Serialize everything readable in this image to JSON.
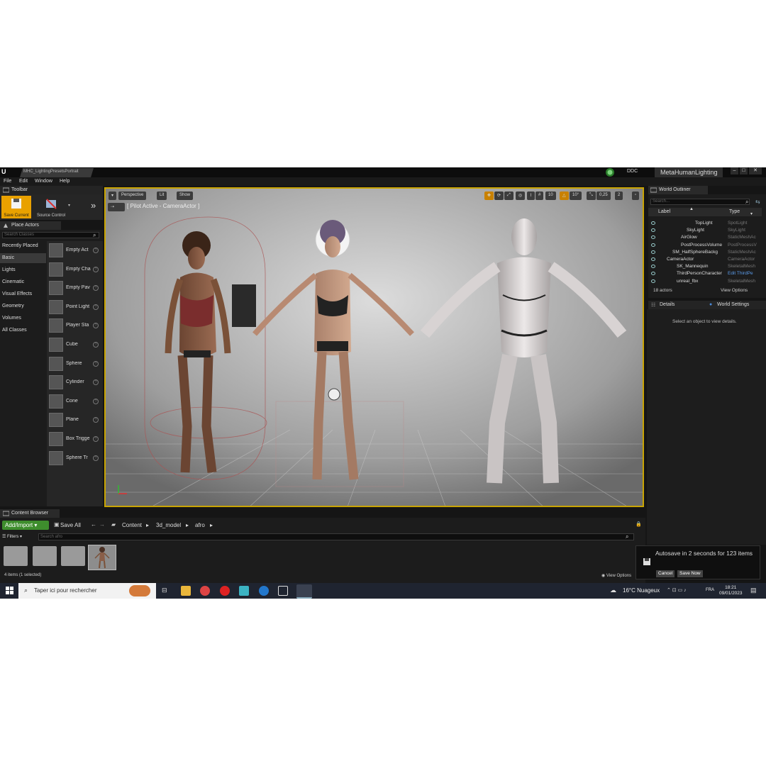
{
  "window": {
    "level_tab": "MHC_LightingPresetsPortrait",
    "ddc_label": "DDC",
    "project_name": "MetaHumanLighting"
  },
  "menu": [
    "File",
    "Edit",
    "Window",
    "Help"
  ],
  "toolbar": {
    "tab_label": "Toolbar",
    "save_current": "Save Current",
    "source_control": "Source Control"
  },
  "place_actors": {
    "tab_label": "Place Actors",
    "search_placeholder": "Search Classes",
    "categories": [
      "Recently Placed",
      "Basic",
      "Lights",
      "Cinematic",
      "Visual Effects",
      "Geometry",
      "Volumes",
      "All Classes"
    ],
    "active_category": "Basic",
    "actors": [
      {
        "label": "Empty Act",
        "icon": "sphere-icon"
      },
      {
        "label": "Empty Cha",
        "icon": "character-icon"
      },
      {
        "label": "Empty Pav",
        "icon": "pawn-icon"
      },
      {
        "label": "Point Light",
        "icon": "bulb-icon"
      },
      {
        "label": "Player Sta",
        "icon": "player-start-icon"
      },
      {
        "label": "Cube",
        "icon": "cube-icon"
      },
      {
        "label": "Sphere",
        "icon": "sphere-icon"
      },
      {
        "label": "Cylinder",
        "icon": "cylinder-icon"
      },
      {
        "label": "Cone",
        "icon": "cone-icon"
      },
      {
        "label": "Plane",
        "icon": "plane-icon"
      },
      {
        "label": "Box Trigge",
        "icon": "box-trigger-icon"
      },
      {
        "label": "Sphere Tr",
        "icon": "sphere-trigger-icon"
      }
    ]
  },
  "viewport": {
    "perspective": "Perspective",
    "lit": "Lit",
    "show": "Show",
    "pilot_label": "[ Pilot Active - CameraActor ]",
    "grid_snap": "10",
    "rot_snap": "10°",
    "scale_snap": "0,25",
    "cam_speed": "2"
  },
  "world_outliner": {
    "tab_label": "World Outliner",
    "search_placeholder": "Search...",
    "col_label": "Label",
    "col_type": "Type",
    "rows": [
      {
        "label": "TopLight",
        "type": "SpotLight"
      },
      {
        "label": "SkyLight",
        "type": "SkyLight"
      },
      {
        "label": "AirGlow",
        "type": "StaticMeshAc"
      },
      {
        "label": "PostProcessVolume",
        "type": "PostProcessV"
      },
      {
        "label": "SM_HalfSphereBackg",
        "type": "StaticMeshAc"
      },
      {
        "label": "CameraActor",
        "type": "CameraActor"
      },
      {
        "label": "SK_Mannequin",
        "type": "SkeletalMesh"
      },
      {
        "label": "ThirdPersonCharacter",
        "type": "Edit ThirdPe"
      },
      {
        "label": "unreal_fbx",
        "type": "SkeletalMesh"
      }
    ],
    "actor_count": "18 actors",
    "view_options": "View Options"
  },
  "details": {
    "tab_details": "Details",
    "tab_world": "World Settings",
    "empty_msg": "Select an object to view details."
  },
  "content_browser": {
    "tab_label": "Content Browser",
    "add_import": "Add/Import",
    "save_all": "Save All",
    "breadcrumbs": [
      "Content",
      "3d_model",
      "afro"
    ],
    "filters": "Filters",
    "search_placeholder": "Search afro",
    "item_count": "4 items (1 selected)",
    "view_options": "View Options"
  },
  "autosave": {
    "message": "Autosave in 2 seconds for 123 items",
    "cancel": "Cancel",
    "save_now": "Save Now"
  },
  "taskbar": {
    "search_placeholder": "Taper ici pour rechercher",
    "weather": "16°C  Nuageux",
    "lang": "FRA",
    "time": "18:21",
    "date": "09/01/2023"
  },
  "colors": {
    "accent_yellow": "#e9a100",
    "add_green": "#3e8d2d",
    "viewport_border": "#c9a400"
  }
}
